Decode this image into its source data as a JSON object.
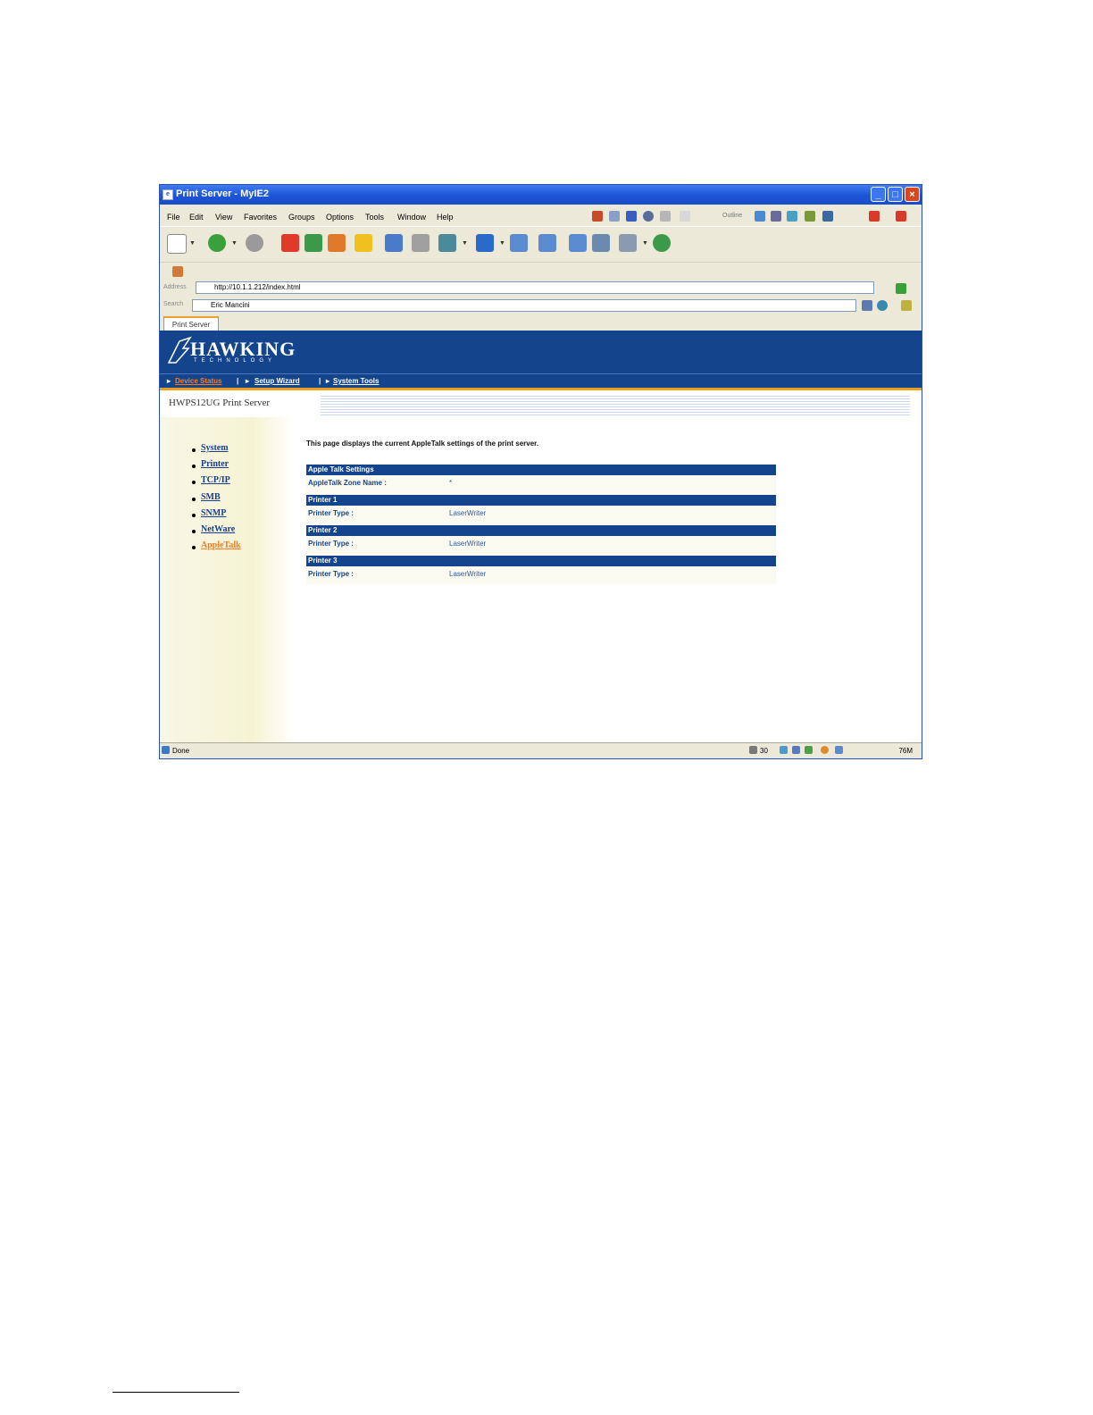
{
  "window": {
    "title": "Print Server - MyIE2",
    "icon": "browser-icon"
  },
  "menu": [
    "File",
    "Edit",
    "View",
    "Favorites",
    "Groups",
    "Options",
    "Tools",
    "Window",
    "Help"
  ],
  "menubar_extra": {
    "outline_label": "Outline"
  },
  "address": {
    "label": "Address",
    "url": "http://10.1.1.212/index.html"
  },
  "search": {
    "label": "Search",
    "value": "Eric Mancini"
  },
  "tab": {
    "label": "Print Server"
  },
  "site": {
    "logo": "HAWKING",
    "logo_sub": "TECHNOLOGY",
    "nav": [
      "Device Status",
      "Setup Wizard",
      "System Tools"
    ],
    "nav_active_color": "#ff7a1a",
    "product": "HWPS12UG Print Server"
  },
  "sidebar": {
    "items": [
      {
        "label": "System",
        "active": false
      },
      {
        "label": "Printer",
        "active": false
      },
      {
        "label": "TCP/IP",
        "active": false
      },
      {
        "label": "SMB",
        "active": false
      },
      {
        "label": "SNMP",
        "active": false
      },
      {
        "label": "NetWare",
        "active": false
      },
      {
        "label": "AppleTalk",
        "active": true
      }
    ]
  },
  "main": {
    "intro": "This page displays the current AppleTalk settings of the print server.",
    "sections": [
      {
        "title": "Apple Talk Settings",
        "key": "AppleTalk Zone Name :",
        "value": "*"
      },
      {
        "title": "Printer 1",
        "key": "Printer Type :",
        "value": "LaserWriter"
      },
      {
        "title": "Printer 2",
        "key": "Printer Type :",
        "value": "LaserWriter"
      },
      {
        "title": "Printer 3",
        "key": "Printer Type :",
        "value": "LaserWriter"
      }
    ]
  },
  "status": {
    "text": "Done",
    "count": "30",
    "zoom": "76M"
  },
  "colors": {
    "brand": "#13448c",
    "accent": "#e8a020",
    "link": "#1a3f8f"
  }
}
